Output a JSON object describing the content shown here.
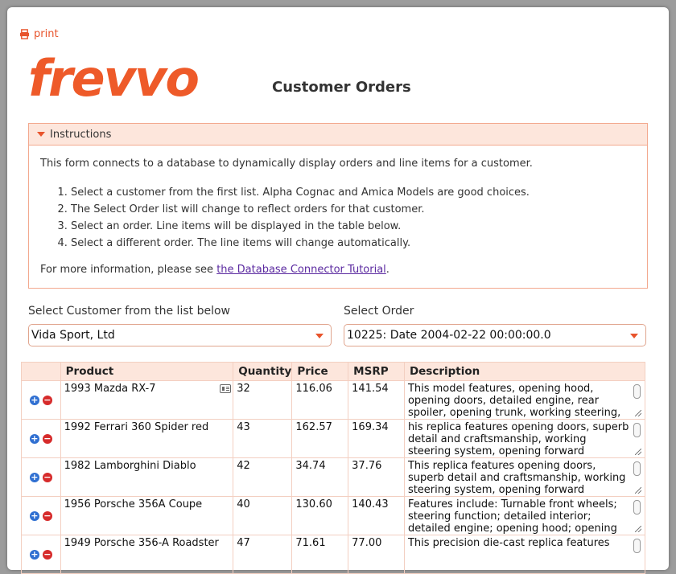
{
  "print_label": "print",
  "logo_text": "frevvo",
  "form_title": "Customer Orders",
  "instructions": {
    "header": "Instructions",
    "intro": "This form connects to a database to dynamically display orders and line items for a customer.",
    "steps": [
      "Select a customer from the first list. Alpha Cognac and Amica Models are good choices.",
      "The Select Order list will change to reflect orders for that customer.",
      "Select an order. Line items will be displayed in the table below.",
      "Select a different order. The line items will change automatically."
    ],
    "more_prefix": "For more information, please see ",
    "more_link": "the Database Connector Tutorial",
    "more_suffix": "."
  },
  "customer": {
    "label": "Select Customer from the list below",
    "value": "Vida Sport, Ltd"
  },
  "order": {
    "label": "Select Order",
    "value": "10225: Date 2004-02-22 00:00:00.0"
  },
  "table": {
    "headers": [
      "Product",
      "Quantity",
      "Price",
      "MSRP",
      "Description"
    ],
    "rows": [
      {
        "product": "1993 Mazda RX-7",
        "quantity": "32",
        "price": "116.06",
        "msrp": "141.54",
        "description": "This model features, opening hood, opening doors, detailed engine, rear spoiler, opening trunk, working steering,"
      },
      {
        "product": "1992 Ferrari 360 Spider red",
        "quantity": "43",
        "price": "162.57",
        "msrp": "169.34",
        "description": "his replica features opening doors, superb detail and craftsmanship, working steering system, opening forward"
      },
      {
        "product": "1982 Lamborghini Diablo",
        "quantity": "42",
        "price": "34.74",
        "msrp": "37.76",
        "description": "This replica features opening doors, superb detail and craftsmanship, working steering system, opening forward"
      },
      {
        "product": "1956 Porsche 356A Coupe",
        "quantity": "40",
        "price": "130.60",
        "msrp": "140.43",
        "description": "Features include: Turnable front wheels; steering function; detailed interior; detailed engine; opening hood; opening"
      },
      {
        "product": "1949 Porsche 356-A Roadster",
        "quantity": "47",
        "price": "71.61",
        "msrp": "77.00",
        "description": "This precision die-cast replica features"
      }
    ]
  },
  "colors": {
    "accent": "#ee5a29",
    "header_bg": "#fde6dc",
    "border": "#f3a98f",
    "link": "#5b2aa0"
  }
}
